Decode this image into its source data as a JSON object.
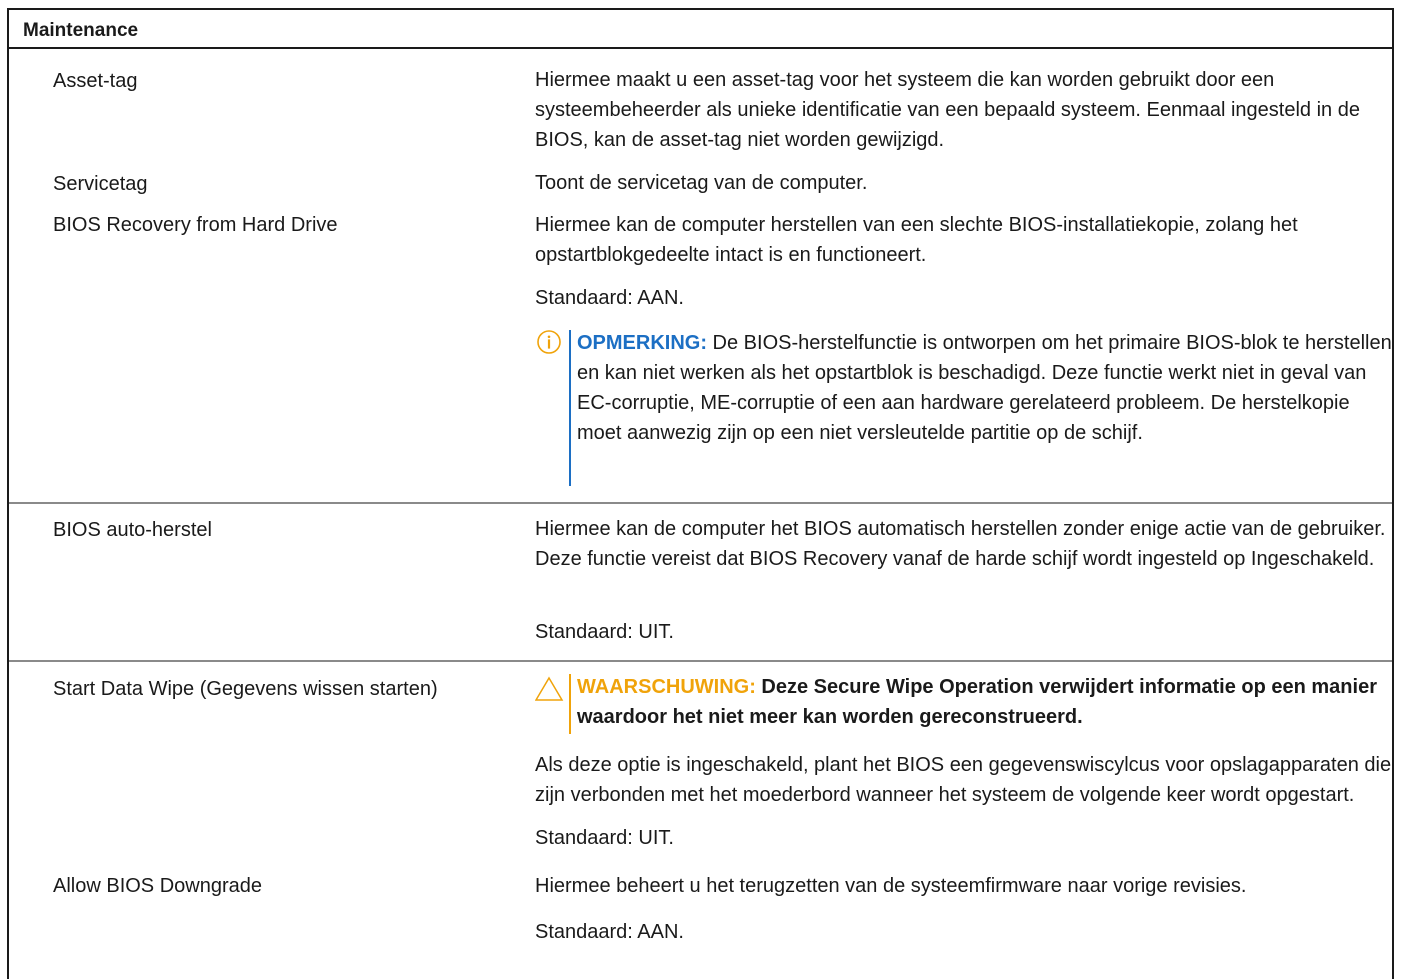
{
  "header": {
    "title": "Maintenance"
  },
  "colors": {
    "info_accent": "#1c6fc4",
    "warning_accent": "#f0a30a",
    "border": "#1a1a1a",
    "separator": "#8a8a8a"
  },
  "rows": {
    "asset_tag": {
      "name": "Asset-tag",
      "desc": "Hiermee maakt u een asset-tag voor het systeem die kan worden gebruikt door een systeembeheerder als unieke identificatie van een bepaald systeem. Eenmaal ingesteld in de BIOS, kan de asset-tag niet worden gewijzigd."
    },
    "service_tag": {
      "name": "Servicetag",
      "desc": "Toont de servicetag van de computer."
    },
    "bios_recovery": {
      "name": "BIOS Recovery from Hard Drive",
      "desc": "Hiermee kan de computer herstellen van een slechte BIOS-installatiekopie, zolang het opstartblokgedeelte intact is en functioneert.",
      "default": "Standaard: AAN.",
      "note_icon": "info-icon",
      "note_label": "OPMERKING:",
      "note_text": " De BIOS-herstelfunctie is ontworpen om het primaire BIOS-blok te herstellen en kan niet werken als het opstartblok is beschadigd. Deze functie werkt niet in geval van EC-corruptie, ME-corruptie of een aan hardware gerelateerd probleem. De herstelkopie moet aanwezig zijn op een niet versleutelde partitie op de schijf."
    },
    "bios_auto_recovery": {
      "name": "BIOS auto-herstel",
      "desc": "Hiermee kan de computer het BIOS automatisch herstellen zonder enige actie van de gebruiker. Deze functie vereist dat BIOS Recovery vanaf de harde schijf wordt ingesteld op Ingeschakeld.",
      "default": "Standaard: UIT."
    },
    "data_wipe": {
      "name": "Start Data Wipe (Gegevens wissen starten)",
      "warn_icon": "warning-triangle-icon",
      "warn_label": "WAARSCHUWING:",
      "warn_text": " Deze Secure Wipe Operation verwijdert informatie op een manier waardoor het niet meer kan worden gereconstrueerd.",
      "desc": "Als deze optie is ingeschakeld, plant het BIOS een gegevenswiscylcus voor opslagapparaten die zijn verbonden met het moederbord wanneer het systeem de volgende keer wordt opgestart.",
      "default": "Standaard: UIT."
    },
    "bios_downgrade": {
      "name": "Allow BIOS Downgrade",
      "desc": "Hiermee beheert u het terugzetten van de systeemfirmware naar vorige revisies.",
      "default": "Standaard: AAN."
    }
  }
}
